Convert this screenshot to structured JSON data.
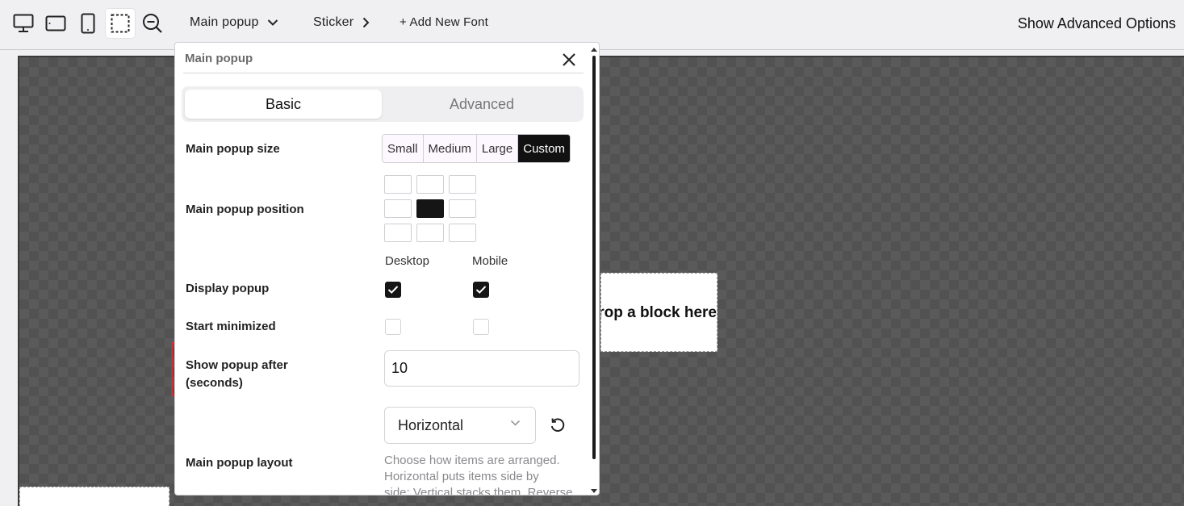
{
  "toolbar": {
    "icons": [
      "desktop-icon",
      "tablet-landscape-icon",
      "mobile-icon",
      "selection-icon",
      "zoom-out-icon"
    ],
    "popup_selector": "Main popup",
    "sticker_label": "Sticker",
    "add_font_label": "+ Add New Font",
    "advanced_options": "Show Advanced Options"
  },
  "canvas": {
    "drop_text": "Drop a block here"
  },
  "panel": {
    "title": "Main popup",
    "tabs": {
      "basic": "Basic",
      "advanced": "Advanced"
    },
    "size": {
      "label": "Main popup size",
      "options": [
        "Small",
        "Medium",
        "Large",
        "Custom"
      ],
      "selected": "Custom"
    },
    "position": {
      "label": "Main popup position",
      "selected": "center"
    },
    "columns": {
      "desktop": "Desktop",
      "mobile": "Mobile"
    },
    "display_popup": {
      "label": "Display popup",
      "desktop": true,
      "mobile": true
    },
    "start_minimized": {
      "label": "Start minimized",
      "desktop": false,
      "mobile": false
    },
    "show_after": {
      "label_line1": "Show popup after",
      "label_line2": "(seconds)",
      "value": "10"
    },
    "layout": {
      "label": "Main popup layout",
      "value": "Horizontal",
      "help_line1": "Choose how items are arranged.",
      "help_line2": "Horizontal puts items side by",
      "help_line3": "side; Vertical stacks them. Reverse"
    }
  },
  "colors": {
    "highlight": "#e0262b",
    "selected": "#111111"
  }
}
